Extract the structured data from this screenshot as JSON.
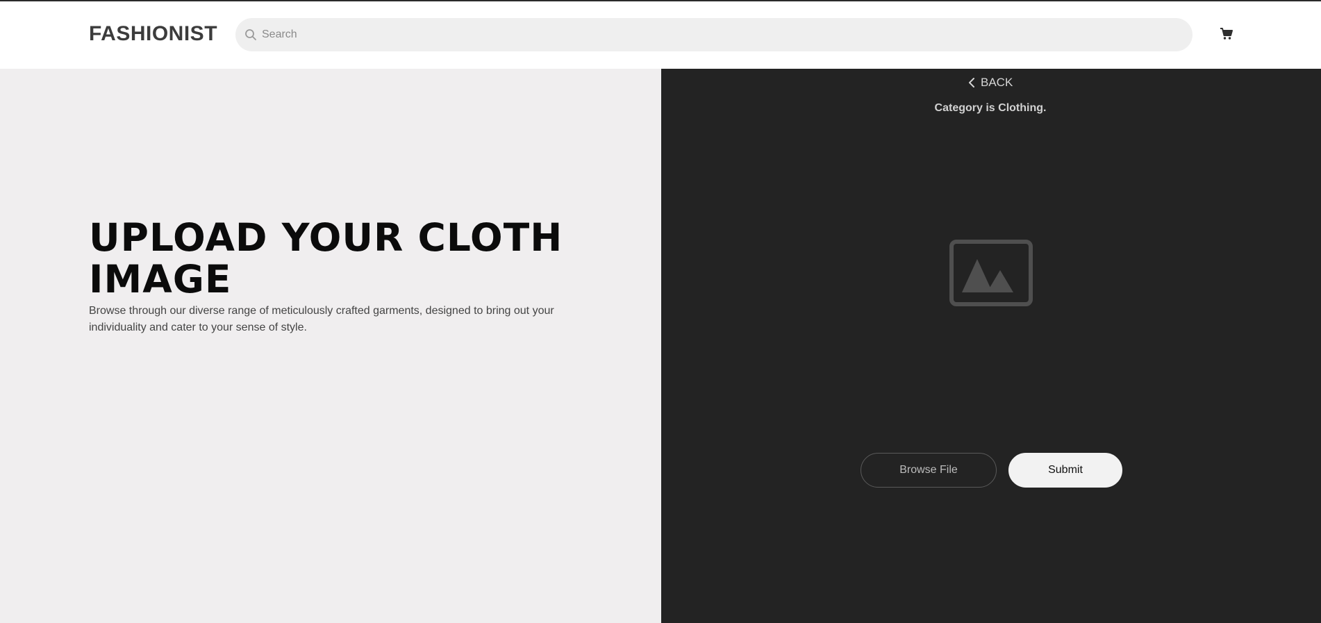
{
  "header": {
    "logo": "FASHIONIST",
    "search_placeholder": "Search",
    "search_value": ""
  },
  "hero": {
    "title": "UPLOAD YOUR CLOTH IMAGE",
    "description": "Browse through our diverse range of meticulously crafted garments, designed to bring out your individuality and cater to your sense of style."
  },
  "upload": {
    "back_label": "BACK",
    "category_text": "Category is Clothing.",
    "browse_label": "Browse File",
    "submit_label": "Submit"
  },
  "icons": {
    "search": "search-icon",
    "cart": "cart-icon",
    "back": "chevron-left-icon",
    "image": "image-placeholder-icon"
  },
  "colors": {
    "left_panel_bg": "#f0eeef",
    "right_panel_bg": "#232323",
    "search_bg": "#efefef",
    "submit_bg": "#f2f2f2"
  }
}
